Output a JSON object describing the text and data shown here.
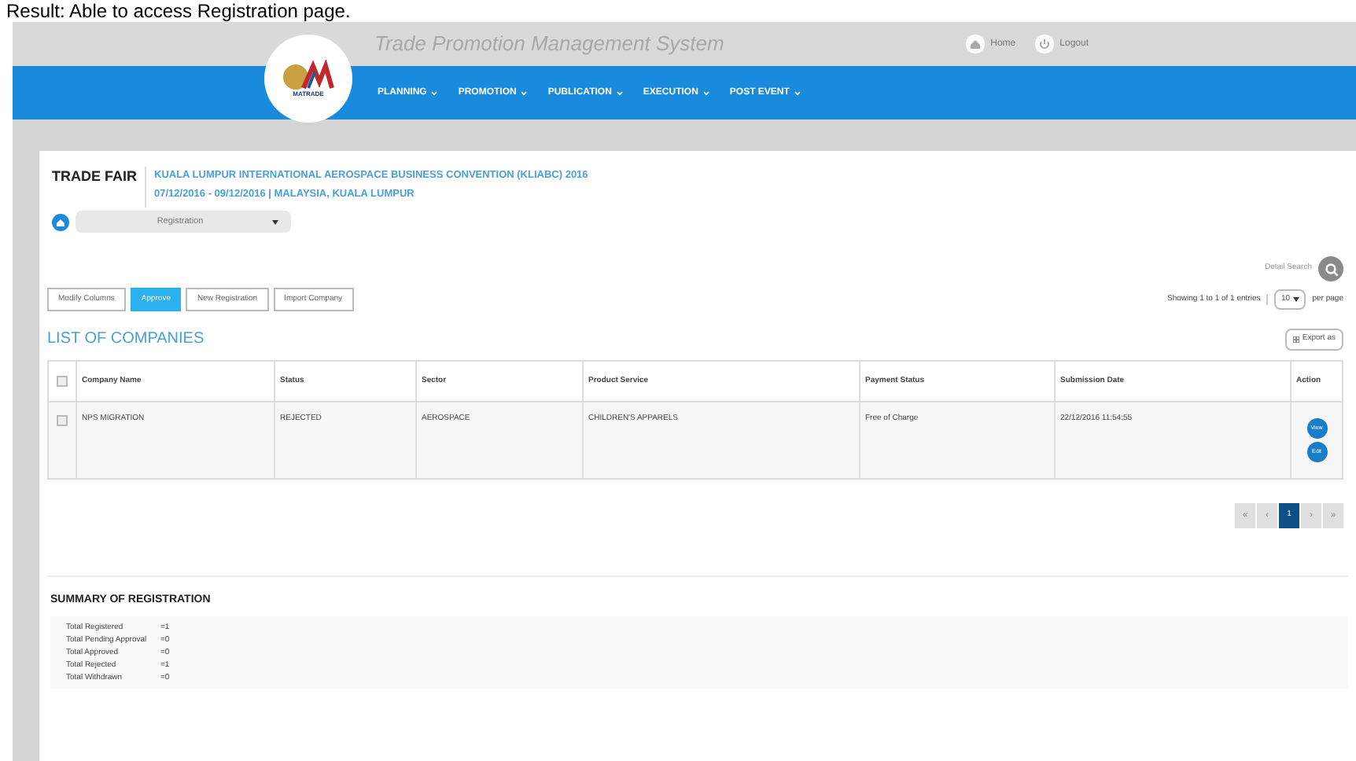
{
  "caption": "Result: Able to access Registration page.",
  "header": {
    "title": "Trade Promotion Management System",
    "links": [
      {
        "label": "Home",
        "kind": "home"
      },
      {
        "label": "Logout",
        "kind": "power"
      }
    ]
  },
  "logo": {
    "text": "MATRADE"
  },
  "nav": [
    {
      "label": "PLANNING"
    },
    {
      "label": "PROMOTION"
    },
    {
      "label": "PUBLICATION"
    },
    {
      "label": "EXECUTION"
    },
    {
      "label": "POST EVENT"
    }
  ],
  "event": {
    "type": "TRADE FAIR",
    "name": "KUALA LUMPUR INTERNATIONAL AEROSPACE BUSINESS CONVENTION (KLIABC) 2016",
    "details": "07/12/2016 - 09/12/2016 | MALAYSIA, KUALA LUMPUR"
  },
  "module_select": {
    "value": "Registration"
  },
  "detail_search": {
    "label": "Detail Search"
  },
  "toolbar": [
    {
      "label": "Modify Columns",
      "selected": false
    },
    {
      "label": "Approve",
      "selected": true
    },
    {
      "label": "New Registration",
      "selected": false
    },
    {
      "label": "Import Company",
      "selected": false
    }
  ],
  "showing": "Showing 1 to 1 of 1 entries",
  "per_page": {
    "value": "10",
    "label": "per page"
  },
  "list_title": "LIST OF COMPANIES",
  "export": {
    "label": "Export as"
  },
  "table": {
    "select_all_checked": false,
    "columns": [
      "Company Name",
      "Status",
      "Sector",
      "Product Service",
      "Payment Status",
      "Submission Date",
      "Action"
    ],
    "rows": [
      {
        "checked": false,
        "cells": [
          "NPS MIGRATION",
          "REJECTED",
          "AEROSPACE",
          "CHILDREN'S APPARELS",
          "Free of Charge",
          "22/12/2016 11:54:55"
        ],
        "actions": [
          "View",
          "Edit"
        ]
      }
    ]
  },
  "pagination": [
    {
      "label": "«",
      "selected": false
    },
    {
      "label": "‹",
      "selected": false
    },
    {
      "label": "1",
      "selected": true
    },
    {
      "label": "›",
      "selected": false
    },
    {
      "label": "»",
      "selected": false
    }
  ],
  "summary": {
    "title": "SUMMARY OF REGISTRATION",
    "rows": [
      {
        "label": "Total Registered",
        "value": "=1"
      },
      {
        "label": "Total Pending Approval",
        "value": "=0"
      },
      {
        "label": "Total Approved",
        "value": "=0"
      },
      {
        "label": "Total Rejected",
        "value": "=1"
      },
      {
        "label": "Total Withdrawn",
        "value": "=0"
      }
    ]
  }
}
